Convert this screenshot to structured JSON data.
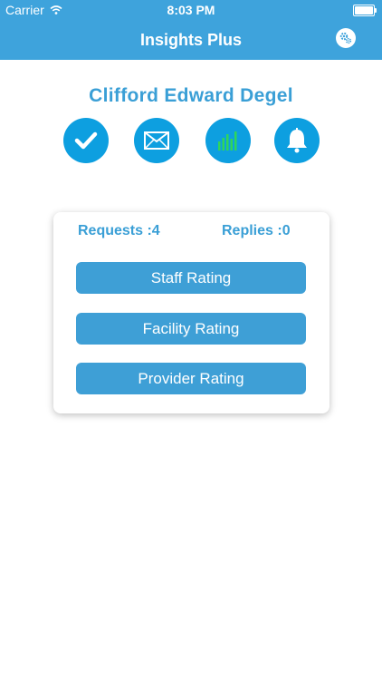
{
  "status_bar": {
    "carrier": "Carrier",
    "time": "8:03 PM"
  },
  "header": {
    "title": "Insights Plus",
    "settings_icon": "gear-icon"
  },
  "profile": {
    "name": "Clifford  Edward Degel"
  },
  "actions": [
    {
      "icon": "checkmark-icon"
    },
    {
      "icon": "envelope-icon"
    },
    {
      "icon": "bar-chart-icon"
    },
    {
      "icon": "bell-icon"
    }
  ],
  "card": {
    "requests_label": "Requests :4",
    "replies_label": "Replies :0",
    "buttons": [
      "Staff Rating",
      "Facility Rating",
      "Provider Rating"
    ]
  },
  "colors": {
    "accent": "#3ea3dc",
    "icon_circle": "#0d9fe0",
    "chart_green": "#2fd65a"
  }
}
